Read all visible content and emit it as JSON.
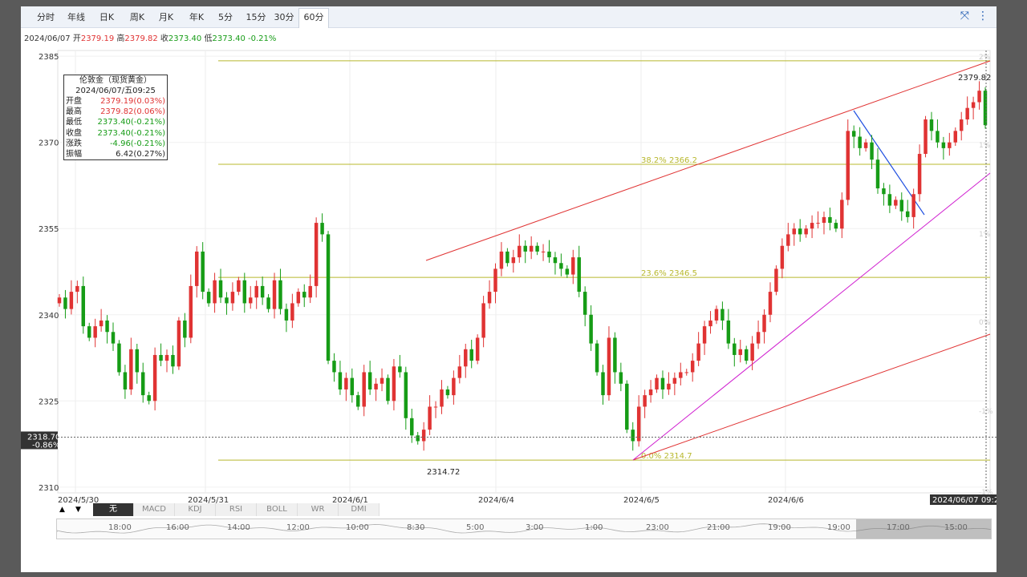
{
  "tabs": [
    "分时",
    "年线",
    "日K",
    "周K",
    "月K",
    "年K",
    "5分",
    "15分",
    "30分",
    "60分"
  ],
  "active_tab": "60分",
  "icons": {
    "fullscreen": "collapse-icon",
    "menu": "more-vertical-icon"
  },
  "info": {
    "date": "2024/06/07",
    "open_label": "开",
    "open": "2379.19",
    "high_label": "高",
    "high": "2379.82",
    "close_label": "收",
    "close": "2373.40",
    "low_label": "低",
    "low": "2373.40",
    "change": "-0.21%"
  },
  "tooltip": {
    "title": "伦敦金（现货黄金）",
    "datetime": "2024/06/07/五09:25",
    "rows": [
      {
        "label": "开盘",
        "value": "2379.19(0.03%)",
        "color": "red"
      },
      {
        "label": "最高",
        "value": "2379.82(0.06%)",
        "color": "red"
      },
      {
        "label": "最低",
        "value": "2373.40(-0.21%)",
        "color": "grn"
      },
      {
        "label": "收盘",
        "value": "2373.40(-0.21%)",
        "color": "grn"
      },
      {
        "label": "涨跌",
        "value": "-4.96(-0.21%)",
        "color": "grn"
      },
      {
        "label": "振幅",
        "value": "6.42(0.27%)",
        "color": "blk"
      }
    ]
  },
  "indicators": [
    "无",
    "MACD",
    "KDJ",
    "RSI",
    "BOLL",
    "WR",
    "DMI"
  ],
  "active_indicator": "无",
  "navigator_labels": [
    "18:00",
    "16:00",
    "14:00",
    "12:00",
    "10:00",
    "8:30",
    "5:00",
    "3:00",
    "1:00",
    "23:00",
    "21:00",
    "19:00",
    "19:00",
    "17:00",
    "15:00"
  ],
  "chart_data": {
    "type": "candlestick",
    "y_ticks": [
      2385,
      2370,
      2355,
      2340,
      2325,
      2310
    ],
    "ylim": [
      2309,
      2386
    ],
    "x_ticks": [
      "2024/5/30",
      "2024/5/31",
      "2024/6/1",
      "2024/6/4",
      "2024/6/5",
      "2024/6/6"
    ],
    "last_x_label": "2024/06/07 09:25",
    "right_pct_ticks": [
      "2%",
      "1%",
      "1%",
      "0%",
      "-1%",
      "-1%"
    ],
    "crosshair": {
      "price": "2318.70",
      "pct": "-0.86%"
    },
    "last_value_label": "2379.82",
    "low_label": "2314.72",
    "fib_levels": [
      {
        "label": "",
        "price": 2384.2
      },
      {
        "label": "38.2% 2366.2",
        "price": 2366.2
      },
      {
        "label": "23.6% 2346.5",
        "price": 2346.5
      },
      {
        "label": "0.0% 2314.7",
        "price": 2314.7
      }
    ],
    "colors": {
      "up": "#e03333",
      "down": "#169c16",
      "fib": "#b8b82e",
      "trend_red": "#e03333",
      "trend_magenta": "#d020d0",
      "trend_blue": "#2050e0"
    },
    "closes": [
      2343,
      2341,
      2344,
      2345,
      2338,
      2336,
      2338,
      2339,
      2337,
      2335,
      2330,
      2327,
      2334,
      2330,
      2326,
      2325,
      2333,
      2332,
      2333,
      2331,
      2339,
      2336,
      2345,
      2351,
      2344,
      2342,
      2346,
      2343,
      2342,
      2344,
      2346,
      2342,
      2343,
      2345,
      2343,
      2341,
      2346,
      2341,
      2339,
      2342,
      2344,
      2343,
      2345,
      2356,
      2354,
      2332,
      2330,
      2327,
      2329,
      2326,
      2324,
      2330,
      2327,
      2328,
      2329,
      2325,
      2331,
      2330,
      2322,
      2319,
      2318,
      2320,
      2324,
      2324,
      2327,
      2326,
      2329,
      2331,
      2334,
      2332,
      2336,
      2342,
      2344,
      2348,
      2351,
      2349,
      2350,
      2352,
      2351,
      2352,
      2351,
      2351,
      2350,
      2349,
      2348,
      2347,
      2350,
      2344,
      2340,
      2335,
      2330,
      2326,
      2336,
      2330,
      2328,
      2320,
      2318,
      2324,
      2326,
      2327,
      2329,
      2327,
      2328,
      2329,
      2330,
      2330,
      2332,
      2335,
      2338,
      2339,
      2341,
      2339,
      2335,
      2333,
      2334,
      2332,
      2335,
      2337,
      2340,
      2344,
      2348,
      2352,
      2354,
      2355,
      2354,
      2355,
      2356,
      2356,
      2357,
      2356,
      2355,
      2360,
      2372,
      2371,
      2369,
      2370,
      2367,
      2362,
      2361,
      2359,
      2360,
      2358,
      2357,
      2361,
      2368,
      2374,
      2372,
      2370,
      2369,
      2370,
      2372,
      2374,
      2376,
      2377,
      2379,
      2373
    ]
  }
}
